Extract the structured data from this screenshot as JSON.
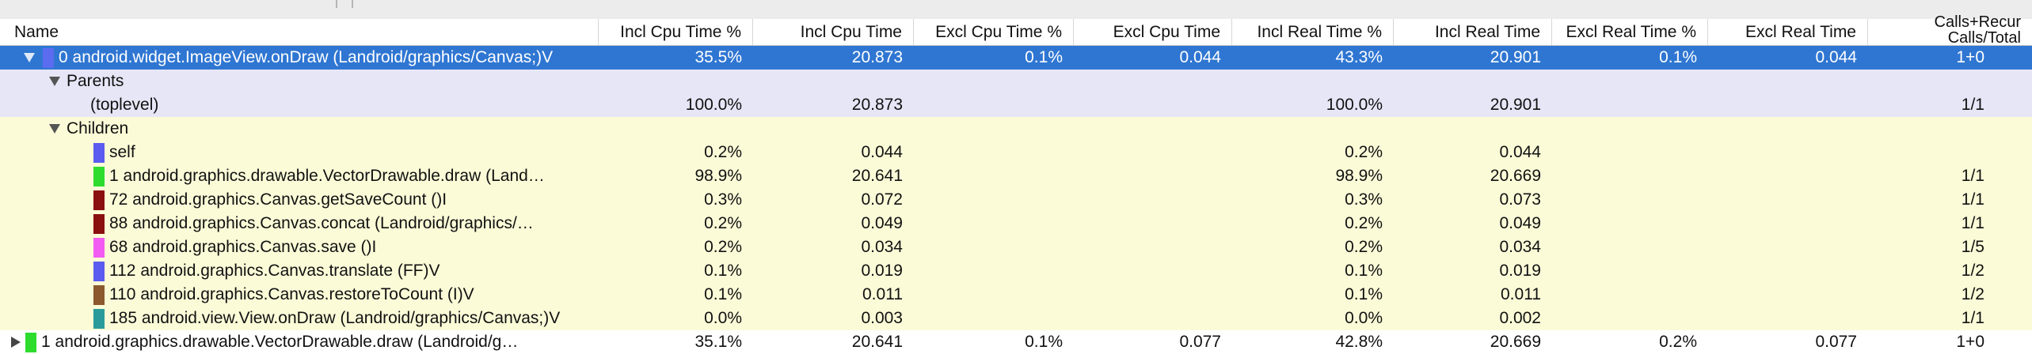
{
  "columns": [
    {
      "key": "name",
      "label": "Name"
    },
    {
      "key": "incl_cpu_pct",
      "label": "Incl Cpu Time %"
    },
    {
      "key": "incl_cpu",
      "label": "Incl Cpu Time"
    },
    {
      "key": "excl_cpu_pct",
      "label": "Excl Cpu Time %"
    },
    {
      "key": "excl_cpu",
      "label": "Excl Cpu Time"
    },
    {
      "key": "incl_real_pct",
      "label": "Incl Real Time %"
    },
    {
      "key": "incl_real",
      "label": "Incl Real Time"
    },
    {
      "key": "excl_real_pct",
      "label": "Excl Real Time %"
    },
    {
      "key": "excl_real",
      "label": "Excl Real Time"
    },
    {
      "key": "calls",
      "label_line1": "Calls+Recur",
      "label_line2": "Calls/Total"
    }
  ],
  "colors": {
    "selection": "#2f76d2",
    "parents_bg": "#e6e6f7",
    "children_bg": "#fbfbd8"
  },
  "rows": [
    {
      "kind": "method",
      "selected": true,
      "expand": "down-icon",
      "swatch": "#5b6cf0",
      "name": "0 android.widget.ImageView.onDraw (Landroid/graphics/Canvas;)V",
      "incl_cpu_pct": "35.5%",
      "incl_cpu": "20.873",
      "excl_cpu_pct": "0.1%",
      "excl_cpu": "0.044",
      "incl_real_pct": "43.3%",
      "incl_real": "20.901",
      "excl_real_pct": "0.1%",
      "excl_real": "0.044",
      "calls": "1+0"
    },
    {
      "kind": "group",
      "group": "parents",
      "expand": "down-icon",
      "name": "Parents"
    },
    {
      "kind": "entry",
      "group": "parents",
      "name": "(toplevel)",
      "incl_cpu_pct": "100.0%",
      "incl_cpu": "20.873",
      "incl_real_pct": "100.0%",
      "incl_real": "20.901",
      "calls": "1/1"
    },
    {
      "kind": "group",
      "group": "children",
      "expand": "down-icon",
      "name": "Children"
    },
    {
      "kind": "entry",
      "group": "children",
      "swatch": "#5b5bf0",
      "name": "self",
      "incl_cpu_pct": "0.2%",
      "incl_cpu": "0.044",
      "incl_real_pct": "0.2%",
      "incl_real": "0.044",
      "calls": ""
    },
    {
      "kind": "entry",
      "group": "children",
      "swatch": "#2edc2e",
      "name": "1 android.graphics.drawable.VectorDrawable.draw (Land…",
      "incl_cpu_pct": "98.9%",
      "incl_cpu": "20.641",
      "incl_real_pct": "98.9%",
      "incl_real": "20.669",
      "calls": "1/1"
    },
    {
      "kind": "entry",
      "group": "children",
      "swatch": "#8b0f0f",
      "name": "72 android.graphics.Canvas.getSaveCount ()I",
      "incl_cpu_pct": "0.3%",
      "incl_cpu": "0.072",
      "incl_real_pct": "0.3%",
      "incl_real": "0.073",
      "calls": "1/1"
    },
    {
      "kind": "entry",
      "group": "children",
      "swatch": "#8b0f0f",
      "name": "88 android.graphics.Canvas.concat (Landroid/graphics/…",
      "incl_cpu_pct": "0.2%",
      "incl_cpu": "0.049",
      "incl_real_pct": "0.2%",
      "incl_real": "0.049",
      "calls": "1/1"
    },
    {
      "kind": "entry",
      "group": "children",
      "swatch": "#f25cf2",
      "name": "68 android.graphics.Canvas.save ()I",
      "incl_cpu_pct": "0.2%",
      "incl_cpu": "0.034",
      "incl_real_pct": "0.2%",
      "incl_real": "0.034",
      "calls": "1/5"
    },
    {
      "kind": "entry",
      "group": "children",
      "swatch": "#5b5bf0",
      "name": "112 android.graphics.Canvas.translate (FF)V",
      "incl_cpu_pct": "0.1%",
      "incl_cpu": "0.019",
      "incl_real_pct": "0.1%",
      "incl_real": "0.019",
      "calls": "1/2"
    },
    {
      "kind": "entry",
      "group": "children",
      "swatch": "#8a5a2e",
      "name": "110 android.graphics.Canvas.restoreToCount (I)V",
      "incl_cpu_pct": "0.1%",
      "incl_cpu": "0.011",
      "incl_real_pct": "0.1%",
      "incl_real": "0.011",
      "calls": "1/2"
    },
    {
      "kind": "entry",
      "group": "children",
      "swatch": "#2a9a9a",
      "name": "185 android.view.View.onDraw (Landroid/graphics/Canvas;)V",
      "incl_cpu_pct": "0.0%",
      "incl_cpu": "0.003",
      "incl_real_pct": "0.0%",
      "incl_real": "0.002",
      "calls": "1/1"
    },
    {
      "kind": "method",
      "selected": false,
      "expand": "right-icon",
      "swatch": "#2edc2e",
      "name": "1 android.graphics.drawable.VectorDrawable.draw (Landroid/g…",
      "incl_cpu_pct": "35.1%",
      "incl_cpu": "20.641",
      "excl_cpu_pct": "0.1%",
      "excl_cpu": "0.077",
      "incl_real_pct": "42.8%",
      "incl_real": "20.669",
      "excl_real_pct": "0.2%",
      "excl_real": "0.077",
      "calls": "1+0"
    }
  ]
}
